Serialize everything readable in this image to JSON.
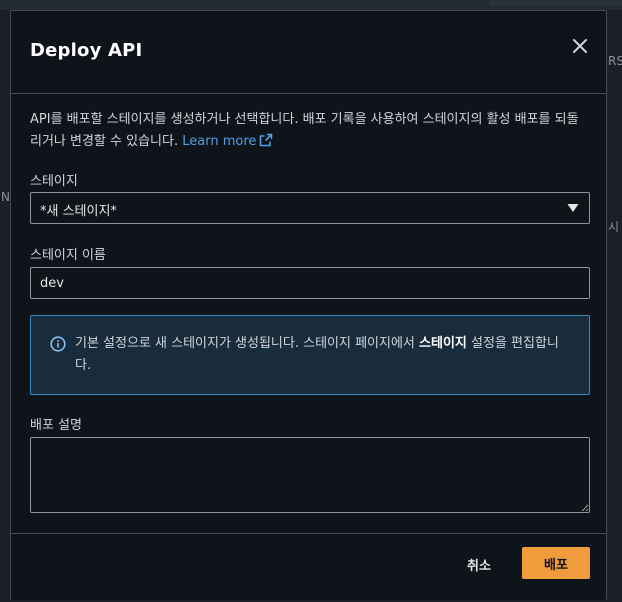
{
  "background": {
    "fragments": [
      "RS",
      "시",
      "N"
    ]
  },
  "modal": {
    "title": "Deploy API",
    "description": "API를 배포할 스테이지를 생성하거나 선택합니다. 배포 기록을 사용하여 스테이지의 활성 배포를 되돌리거나 변경할 수 있습니다.",
    "learn_more": "Learn more",
    "stage": {
      "label": "스테이지",
      "selected": "*새 스테이지*"
    },
    "stage_name": {
      "label": "스테이지 이름",
      "value": "dev"
    },
    "info_alert": {
      "text_before": "기본 설정으로 새 스테이지가 생성됩니다. 스테이지 페이지에서 ",
      "text_bold": "스테이지",
      "text_after": " 설정을 편집합니다."
    },
    "deployment_description": {
      "label": "배포 설명",
      "value": ""
    },
    "cancel_label": "취소",
    "deploy_label": "배포"
  },
  "colors": {
    "accent": "#f19c3c",
    "link": "#539fe5",
    "info_border": "#3a8ac2",
    "modal_bg": "#0f141a"
  }
}
